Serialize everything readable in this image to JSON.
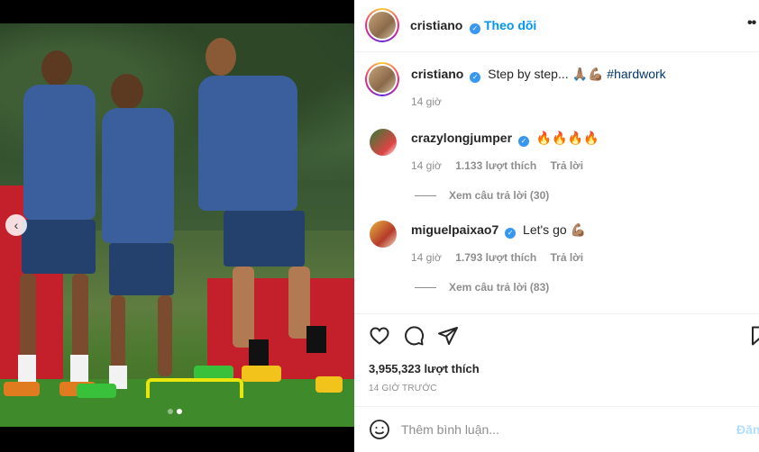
{
  "post": {
    "username": "cristiano",
    "follow_label": "Theo dõi",
    "more_icon": "more-horizontal-icon",
    "caption_text": "Step by step...",
    "caption_emojis": "🙏🏽💪🏽",
    "hashtag": "#hardwork",
    "caption_time": "14 giờ",
    "likes": "3,955,323 lượt thích",
    "time_ago": "14 GIỜ TRƯỚC"
  },
  "comments": [
    {
      "username": "crazylongjumper",
      "text": "🔥🔥🔥🔥",
      "time": "14 giờ",
      "likes": "1.133 lượt thích",
      "reply_label": "Trả lời",
      "view_replies": "Xem câu trả lời (30)"
    },
    {
      "username": "miguelpaixao7",
      "text": "Let's go 💪🏽",
      "time": "14 giờ",
      "likes": "1.793 lượt thích",
      "reply_label": "Trả lời",
      "view_replies": "Xem câu trả lời (83)"
    }
  ],
  "composer": {
    "placeholder": "Thêm bình luận...",
    "post_label": "Đăng"
  },
  "media": {
    "total_slides": 2,
    "active_slide": 2
  },
  "colors": {
    "accent": "#0095f6",
    "verified": "#3897f0",
    "hashtag": "#00376b",
    "muted": "#8e8e8e"
  }
}
